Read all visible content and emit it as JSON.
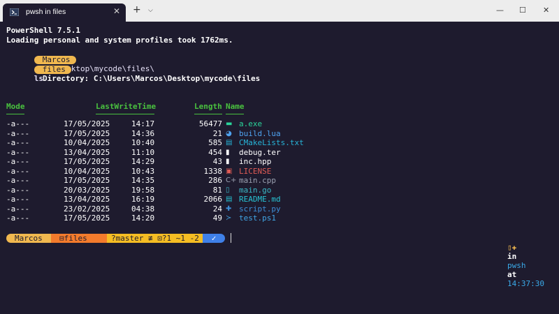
{
  "window": {
    "tab_title": "pwsh in files",
    "tab_close": "✕",
    "new_tab": "+",
    "dropdown": "⌵",
    "minimize": "—",
    "maximize": "☐",
    "close": "✕"
  },
  "terminal": {
    "header_line1": "PowerShell 7.5.1",
    "header_line2": "Loading personal and system profiles took 1762ms.",
    "prompt1_user": "Marcos",
    "prompt1_cmd": "cd .\\Desktop\\mycode\\files\\",
    "prompt2_dir": "files",
    "prompt2_cmd": "ls",
    "directory_line": "Directory: C:\\Users\\Marcos\\Desktop\\mycode\\files",
    "columns": {
      "mode": "Mode",
      "lastwrite": "LastWriteTime",
      "length": "Length",
      "name": "Name"
    },
    "files": [
      {
        "mode": "-a---",
        "date": "17/05/2025",
        "time": "14:17",
        "length": "56477",
        "name": "a.exe",
        "icon": "executable-icon",
        "glyph": "▬",
        "color": "#2ad49a"
      },
      {
        "mode": "-a---",
        "date": "17/05/2025",
        "time": "14:36",
        "length": "21",
        "name": "build.lua",
        "icon": "lua-icon",
        "glyph": "◕",
        "color": "#4fa3f0"
      },
      {
        "mode": "-a---",
        "date": "10/04/2025",
        "time": "10:40",
        "length": "585",
        "name": "CMakeLists.txt",
        "icon": "text-file-icon",
        "glyph": "▤",
        "color": "#27b4d8"
      },
      {
        "mode": "-a---",
        "date": "13/04/2025",
        "time": "11:10",
        "length": "454",
        "name": "debug.ter",
        "icon": "file-icon",
        "glyph": "▮",
        "color": "#ffffff"
      },
      {
        "mode": "-a---",
        "date": "17/05/2025",
        "time": "14:29",
        "length": "43",
        "name": "inc.hpp",
        "icon": "file-icon",
        "glyph": "▮",
        "color": "#ffffff"
      },
      {
        "mode": "-a---",
        "date": "10/04/2025",
        "time": "10:43",
        "length": "1338",
        "name": "LICENSE",
        "icon": "license-icon",
        "glyph": "▣",
        "color": "#e05b55"
      },
      {
        "mode": "-a---",
        "date": "17/05/2025",
        "time": "14:35",
        "length": "286",
        "name": "main.cpp",
        "icon": "cpp-icon",
        "glyph": "C+",
        "color": "#9aa0b0"
      },
      {
        "mode": "-a---",
        "date": "20/03/2025",
        "time": "19:58",
        "length": "81",
        "name": "main.go",
        "icon": "go-icon",
        "glyph": "▯",
        "color": "#3bb8c7"
      },
      {
        "mode": "-a---",
        "date": "13/04/2025",
        "time": "16:19",
        "length": "2066",
        "name": "README.md",
        "icon": "markdown-icon",
        "glyph": "▤",
        "color": "#27c4d4"
      },
      {
        "mode": "-a---",
        "date": "23/02/2025",
        "time": "04:38",
        "length": "24",
        "name": "script.py",
        "icon": "python-icon",
        "glyph": "✚",
        "color": "#3d8fd8"
      },
      {
        "mode": "-a---",
        "date": "17/05/2025",
        "time": "14:20",
        "length": "49",
        "name": "test.ps1",
        "icon": "powershell-icon",
        "glyph": "≻",
        "color": "#40a6e6"
      }
    ]
  },
  "status_prompt": {
    "user": "Marcos",
    "path": "files",
    "path_icon": "⊟",
    "git": "?master ≢ ⊡?1 ~1 -2",
    "ok": "✓",
    "right_icons": "▯✚",
    "right_in": "in",
    "right_shell": "pwsh",
    "right_at": "at",
    "right_time": "14:37:30",
    "colors": {
      "user": "#f0b84f",
      "path": "#f37b2c",
      "git": "#f5bd23",
      "ok": "#3f80e8",
      "time": "#3aa9e8"
    }
  }
}
